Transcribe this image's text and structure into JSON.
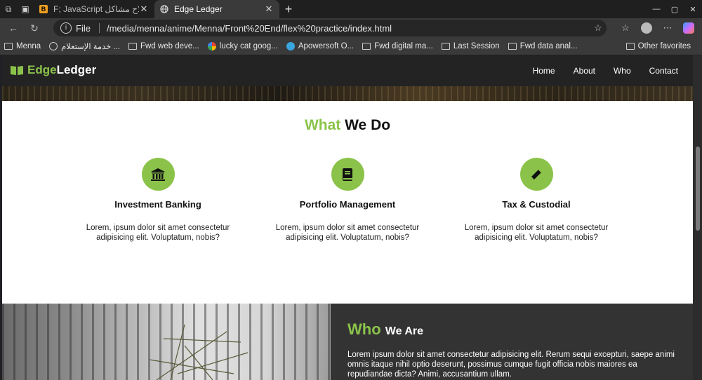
{
  "browser": {
    "tabs": [
      {
        "title": "JavaScript إصلاح مشاكل",
        "prefix": "F;",
        "active": false
      },
      {
        "title": "Edge Ledger",
        "active": true
      }
    ],
    "address": {
      "scheme_label": "File",
      "url": "/media/menna/anime/Menna/Front%20End/flex%20practice/index.html"
    },
    "bookmarks": [
      {
        "label": "Menna",
        "icon": "folder-icon"
      },
      {
        "label": "خدمة الإستعلام ...",
        "icon": "globe-icon"
      },
      {
        "label": "Fwd web deve...",
        "icon": "folder-icon"
      },
      {
        "label": "lucky cat goog...",
        "icon": "google-icon"
      },
      {
        "label": "Apowersoft O...",
        "icon": "apowersoft-icon"
      },
      {
        "label": "Fwd digital ma...",
        "icon": "folder-icon"
      },
      {
        "label": "Last Session",
        "icon": "folder-icon"
      },
      {
        "label": "Fwd data anal...",
        "icon": "folder-icon"
      }
    ],
    "other_favorites": "Other favorites"
  },
  "site": {
    "logo": {
      "edge": "Edge",
      "ledger": "Ledger"
    },
    "nav": [
      "Home",
      "About",
      "Who",
      "Contact"
    ],
    "what_we_do": {
      "accent": "What",
      "rest": "We Do",
      "services": [
        {
          "icon": "bank-icon",
          "title": "Investment Banking",
          "text": "Lorem, ipsum dolor sit amet consectetur adipisicing elit. Voluptatum, nobis?"
        },
        {
          "icon": "book-icon",
          "title": "Portfolio Management",
          "text": "Lorem, ipsum dolor sit amet consectetur adipisicing elit. Voluptatum, nobis?"
        },
        {
          "icon": "pencil-icon",
          "title": "Tax & Custodial",
          "text": "Lorem, ipsum dolor sit amet consectetur adipisicing elit. Voluptatum, nobis?"
        }
      ]
    },
    "who_we_are": {
      "accent": "Who",
      "rest": "We Are",
      "text": "Lorem ipsum dolor sit amet consectetur adipisicing elit. Rerum sequi excepturi, saepe animi omnis itaque nihil optio deserunt, possimus cumque fugit officia nobis maiores ea repudiandae dicta? Animi, accusantium ullam."
    }
  },
  "colors": {
    "accent": "#8bc34a",
    "header": "#232323",
    "dark_section": "#333333"
  }
}
